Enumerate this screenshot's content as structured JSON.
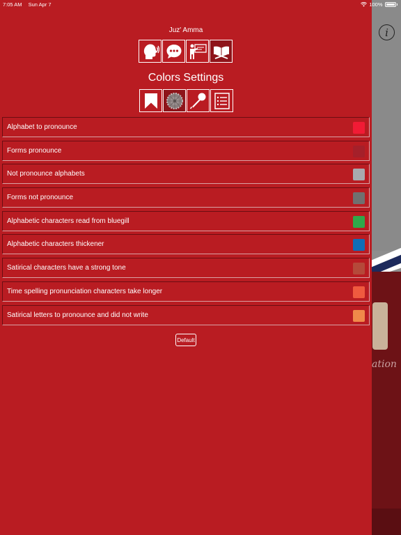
{
  "status_bar": {
    "time": "7:05 AM",
    "date": "Sun Apr 7",
    "battery": "100%"
  },
  "app_title": "Juz' Amma",
  "top_icons": [
    {
      "name": "speaking-head-icon"
    },
    {
      "name": "speech-bubble-icon"
    },
    {
      "name": "teacher-board-icon"
    },
    {
      "name": "open-quran-icon"
    }
  ],
  "section_title": "Colors Settings",
  "tab_icons": [
    {
      "name": "bookmark-icon"
    },
    {
      "name": "color-wheel-icon"
    },
    {
      "name": "microphone-icon"
    },
    {
      "name": "list-icon"
    }
  ],
  "color_settings": [
    {
      "label": "Alphabet to pronounce",
      "color": "#f11b35"
    },
    {
      "label": "Forms pronounce",
      "color": "#a5202a"
    },
    {
      "label": "Not pronounce alphabets",
      "color": "#a8aaaf"
    },
    {
      "label": "Forms not pronounce",
      "color": "#707070"
    },
    {
      "label": "Alphabetic characters read from bluegill",
      "color": "#2fa84a"
    },
    {
      "label": "Alphabetic characters thickener",
      "color": "#0f6eb6"
    },
    {
      "label": "Satirical characters have a strong tone",
      "color": "#b5493a"
    },
    {
      "label": "Time spelling pronunciation characters take longer",
      "color": "#ef5a3f"
    },
    {
      "label": "Satirical letters to pronounce and did not write",
      "color": "#f0894a"
    }
  ],
  "default_button": "Default",
  "background": {
    "script_text": "ation"
  }
}
